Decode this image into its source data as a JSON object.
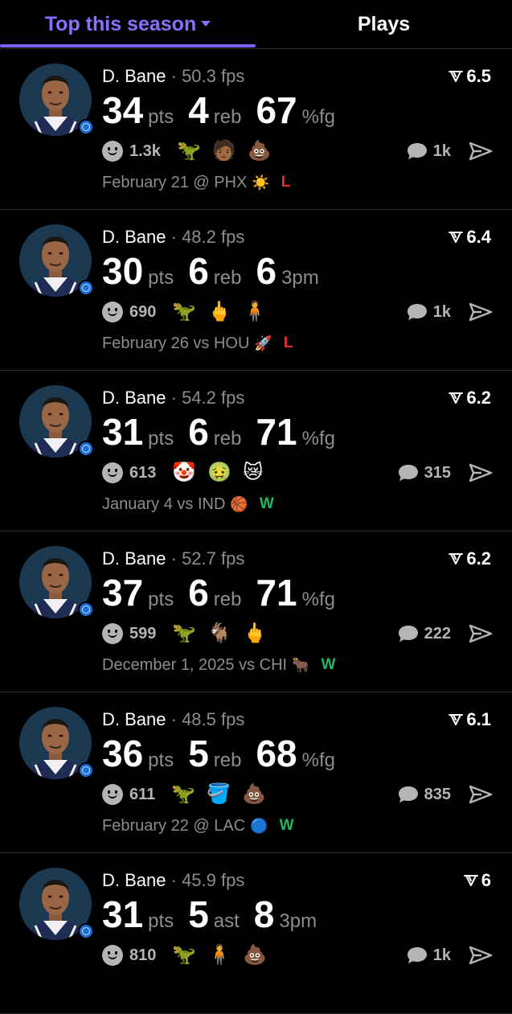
{
  "tabs": {
    "active": "Top this season",
    "other": "Plays"
  },
  "colors": {
    "accent": "#7b61ff",
    "loss": "#e5322c",
    "win": "#1fb864",
    "muted": "#8d8d8d"
  },
  "cards": [
    {
      "name": "D. Bane",
      "fps": "50.3 fps",
      "rating": "6.5",
      "stats": [
        {
          "value": "34",
          "unit": "pts"
        },
        {
          "value": "4",
          "unit": "reb"
        },
        {
          "value": "67",
          "unit": "%fg"
        }
      ],
      "reactions_count": "1.3k",
      "emojis": [
        "🦖",
        "🧑🏾",
        "💩"
      ],
      "comments": "1k",
      "date": "February 21 @ PHX",
      "team_logo": "☀️",
      "result": "L"
    },
    {
      "name": "D. Bane",
      "fps": "48.2 fps",
      "rating": "6.4",
      "stats": [
        {
          "value": "30",
          "unit": "pts"
        },
        {
          "value": "6",
          "unit": "reb"
        },
        {
          "value": "6",
          "unit": "3pm"
        }
      ],
      "reactions_count": "690",
      "emojis": [
        "🦖",
        "🖕",
        "🧍"
      ],
      "comments": "1k",
      "date": "February 26 vs HOU",
      "team_logo": "🚀",
      "result": "L"
    },
    {
      "name": "D. Bane",
      "fps": "54.2 fps",
      "rating": "6.2",
      "stats": [
        {
          "value": "31",
          "unit": "pts"
        },
        {
          "value": "6",
          "unit": "reb"
        },
        {
          "value": "71",
          "unit": "%fg"
        }
      ],
      "reactions_count": "613",
      "emojis": [
        "🤡",
        "🤢",
        "😿"
      ],
      "comments": "315",
      "date": "January 4 vs IND",
      "team_logo": "🏀",
      "result": "W"
    },
    {
      "name": "D. Bane",
      "fps": "52.7 fps",
      "rating": "6.2",
      "stats": [
        {
          "value": "37",
          "unit": "pts"
        },
        {
          "value": "6",
          "unit": "reb"
        },
        {
          "value": "71",
          "unit": "%fg"
        }
      ],
      "reactions_count": "599",
      "emojis": [
        "🦖",
        "🐐",
        "🖕"
      ],
      "comments": "222",
      "date": "December 1, 2025 vs CHI",
      "team_logo": "🐂",
      "result": "W"
    },
    {
      "name": "D. Bane",
      "fps": "48.5 fps",
      "rating": "6.1",
      "stats": [
        {
          "value": "36",
          "unit": "pts"
        },
        {
          "value": "5",
          "unit": "reb"
        },
        {
          "value": "68",
          "unit": "%fg"
        }
      ],
      "reactions_count": "611",
      "emojis": [
        "🦖",
        "🪣",
        "💩"
      ],
      "comments": "835",
      "date": "February 22 @ LAC",
      "team_logo": "🔵",
      "result": "W"
    },
    {
      "name": "D. Bane",
      "fps": "45.9 fps",
      "rating": "6",
      "stats": [
        {
          "value": "31",
          "unit": "pts"
        },
        {
          "value": "5",
          "unit": "ast"
        },
        {
          "value": "8",
          "unit": "3pm"
        }
      ],
      "reactions_count": "810",
      "emojis": [
        "🦖",
        "🧍",
        "💩"
      ],
      "comments": "1k",
      "date": "",
      "team_logo": "",
      "result": ""
    }
  ]
}
